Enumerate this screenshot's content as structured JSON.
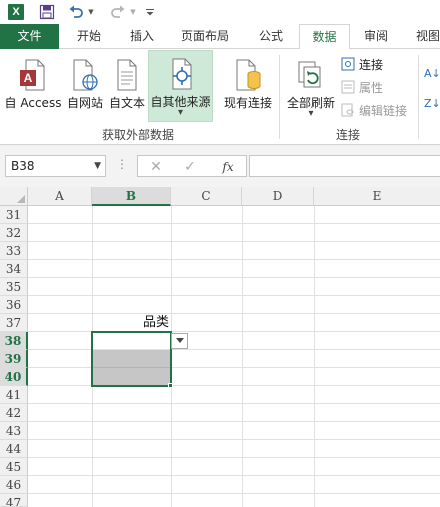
{
  "app": {
    "logo_text": "X"
  },
  "tabs": [
    {
      "label": "文件"
    },
    {
      "label": "开始"
    },
    {
      "label": "插入"
    },
    {
      "label": "页面布局"
    },
    {
      "label": "公式"
    },
    {
      "label": "数据"
    },
    {
      "label": "审阅"
    },
    {
      "label": "视图"
    }
  ],
  "ribbon": {
    "external_group_label": "获取外部数据",
    "connections_group_label": "连接",
    "from_access": "自 Access",
    "from_web": "自网站",
    "from_text": "自文本",
    "from_other": "自其他来源",
    "existing_connections": "现有连接",
    "refresh_all": "全部刷新",
    "connections": "连接",
    "properties": "属性",
    "edit_links": "编辑链接",
    "sort_az": "A↓",
    "sort_za": "Z↓"
  },
  "formula_bar": {
    "name_box": "B38",
    "cancel": "✕",
    "enter": "✓",
    "fx": "fx",
    "value": ""
  },
  "sheet": {
    "columns": [
      "A",
      "B",
      "C",
      "D",
      "E"
    ],
    "rows": [
      "31",
      "32",
      "33",
      "34",
      "35",
      "36",
      "37",
      "38",
      "39",
      "40",
      "41",
      "42",
      "43",
      "44",
      "45",
      "46",
      "47"
    ],
    "selected_column": "B",
    "selected_rows": [
      "38",
      "39",
      "40"
    ],
    "cell_b37": "品类"
  },
  "colors": {
    "accent": "#217346"
  }
}
